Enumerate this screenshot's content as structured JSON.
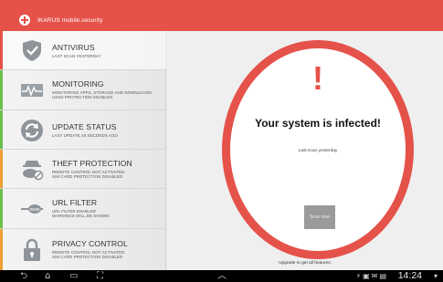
{
  "header": {
    "title": "IKARUS mobile.security",
    "color": "#e5524a"
  },
  "sidebar": {
    "items": [
      {
        "label": "ANTIVIRUS",
        "sub": [
          "LAST SCAN YESTERDAY"
        ],
        "accent": "#e5524a",
        "icon": "shield-check-icon"
      },
      {
        "label": "MONITORING",
        "sub": [
          "MONITORING APPS, STORAGE AND DOWNLOADS",
          "USSD PROTECTION ENABLED"
        ],
        "accent": "#6dbf4b",
        "icon": "pulse-monitor-icon"
      },
      {
        "label": "UPDATE STATUS",
        "sub": [
          "LAST UPDATE 28 SECONDS AGO"
        ],
        "accent": "#6dbf4b",
        "icon": "refresh-icon"
      },
      {
        "label": "THEFT PROTECTION",
        "sub": [
          "REMOTE CONTROL NOT ACTIVATED",
          "SIM CARD PROTECTION DISABLED"
        ],
        "accent": "#f0a030",
        "icon": "thief-icon"
      },
      {
        "label": "URL FILTER",
        "sub": [
          "URL FILTER ENABLED",
          "WARNINGS WILL BE SHOWN"
        ],
        "accent": "#6dbf4b",
        "icon": "url-filter-icon"
      },
      {
        "label": "PRIVACY CONTROL",
        "sub": [
          "REMOTE CONTROL NOT ACTIVATED",
          "SIM CARD PROTECTION DISABLED"
        ],
        "accent": "#f0a030",
        "icon": "lock-icon"
      }
    ]
  },
  "main": {
    "alert_symbol": "!",
    "headline": "Your system is infected!",
    "last_scan": "Last scan yesterday",
    "scan_button": "Scan now",
    "upgrade_text": "Upgrade to get all features."
  },
  "navbar": {
    "clock": "14:24"
  }
}
